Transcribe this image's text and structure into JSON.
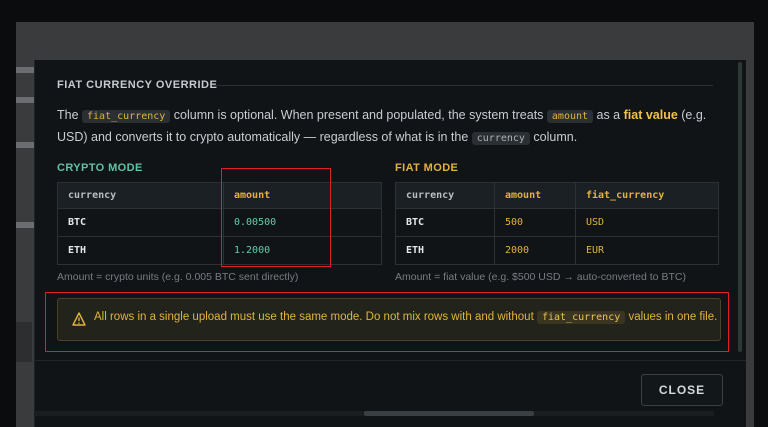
{
  "section_title": "FIAT CURRENCY OVERRIDE",
  "description": {
    "p1": "The ",
    "code1": "fiat_currency",
    "p2": " column is optional. When present and populated, the system treats ",
    "code2": "amount",
    "p3": " as a ",
    "highlight": "fiat value",
    "p4": " (e.g. USD) and converts it to crypto automatically — regardless of what is in the ",
    "code3": "currency",
    "p5": " column."
  },
  "crypto_mode": {
    "title": "CRYPTO MODE",
    "headers": [
      "currency",
      "amount"
    ],
    "rows": [
      [
        "BTC",
        "0.00500"
      ],
      [
        "ETH",
        "1.2000"
      ]
    ],
    "note": "Amount = crypto units (e.g. 0.005 BTC sent directly)"
  },
  "fiat_mode": {
    "title": "FIAT MODE",
    "headers": [
      "currency",
      "amount",
      "fiat_currency"
    ],
    "rows": [
      [
        "BTC",
        "500",
        "USD"
      ],
      [
        "ETH",
        "2000",
        "EUR"
      ]
    ],
    "note": "Amount = fiat value (e.g. $500 USD → auto-converted to BTC)"
  },
  "warning": {
    "icon": "warning-icon",
    "t1": "All rows in a single upload must use the same mode. Do not mix rows with and without ",
    "code": "fiat_currency",
    "t2": " values in one file."
  },
  "close_label": "CLOSE",
  "colors": {
    "accent_gold": "#e2b33c",
    "accent_green": "#5fc3a0",
    "annotation_red": "#e02020",
    "modal_bg": "#101417"
  }
}
